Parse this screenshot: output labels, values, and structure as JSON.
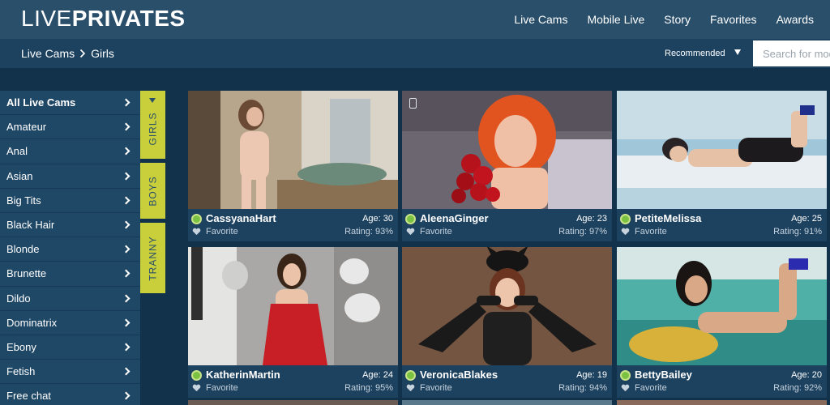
{
  "logo": {
    "light": "LIVE",
    "bold": "PRIVATES"
  },
  "nav": [
    "Live Cams",
    "Mobile Live",
    "Story",
    "Favorites",
    "Awards"
  ],
  "breadcrumb": {
    "root": "Live Cams",
    "current": "Girls"
  },
  "sort": {
    "selected": "Recommended"
  },
  "search": {
    "placeholder": "Search for models"
  },
  "sidebar": [
    "All Live Cams",
    "Amateur",
    "Anal",
    "Asian",
    "Big Tits",
    "Black Hair",
    "Blonde",
    "Brunette",
    "Dildo",
    "Dominatrix",
    "Ebony",
    "Fetish",
    "Free chat"
  ],
  "gender_tabs": [
    "GIRLS",
    "BOYS",
    "TRANNY"
  ],
  "cards": [
    {
      "name": "CassyanaHart",
      "age": "Age: 30",
      "fav": "Favorite",
      "rating": "Rating: 93%"
    },
    {
      "name": "AleenaGinger",
      "age": "Age: 23",
      "fav": "Favorite",
      "rating": "Rating: 97%"
    },
    {
      "name": "PetiteMelissa",
      "age": "Age: 25",
      "fav": "Favorite",
      "rating": "Rating: 91%"
    },
    {
      "name": "KatherinMartin",
      "age": "Age: 24",
      "fav": "Favorite",
      "rating": "Rating: 95%"
    },
    {
      "name": "VeronicaBlakes",
      "age": "Age: 19",
      "fav": "Favorite",
      "rating": "Rating: 94%"
    },
    {
      "name": "BettyBailey",
      "age": "Age: 20",
      "fav": "Favorite",
      "rating": "Rating: 92%"
    }
  ],
  "colors": {
    "topbar": "#2a4f6b",
    "subbar": "#1d4260",
    "background": "#11324a",
    "tab": "#c9cf3b",
    "online": "#7cc242"
  }
}
